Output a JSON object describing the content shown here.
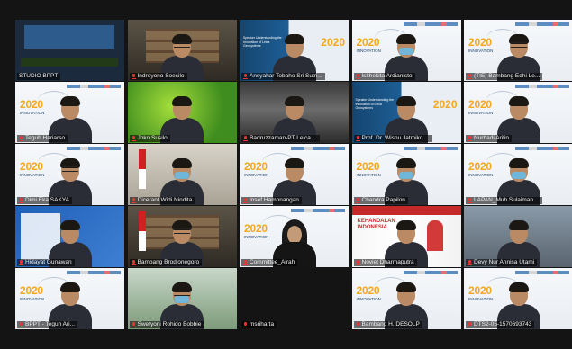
{
  "participants": [
    {
      "label": "STUDIO BPPT",
      "bg": "stage",
      "active": true,
      "muted": false
    },
    {
      "label": "Indroyono Soesilo",
      "bg": "room",
      "muted": true
    },
    {
      "label": "Ansyahar Tobaho Sri Sutri...",
      "bg": "blue",
      "muted": true
    },
    {
      "label": "Iskhekita Ardianisto",
      "bg": "tech",
      "muted": true
    },
    {
      "label": "(TIE) Bambang Edhi Le...",
      "bg": "tech",
      "muted": true
    },
    {
      "label": "Teguh Hariarso",
      "bg": "tech",
      "muted": true
    },
    {
      "label": "Joko Susilo",
      "bg": "green",
      "muted": true
    },
    {
      "label": "Badruzzaman-PT Leica ...",
      "bg": "hall",
      "muted": true
    },
    {
      "label": "Prof. Dr. Wisnu Jatmiko ...",
      "bg": "blue",
      "muted": true
    },
    {
      "label": "Nurhadi Arifin",
      "bg": "tech",
      "muted": true
    },
    {
      "label": "Dimi Eka SAKYA",
      "bg": "tech",
      "muted": true
    },
    {
      "label": "Dicerant Widi Nindita",
      "bg": "office",
      "muted": true
    },
    {
      "label": "Insef Hamonangan",
      "bg": "tech",
      "muted": true
    },
    {
      "label": "Chandra Papilon",
      "bg": "tech",
      "muted": true
    },
    {
      "label": "LAPAN_Muh Sulaiman ...",
      "bg": "tech",
      "muted": true
    },
    {
      "label": "Hidayat Gunawan",
      "bg": "poster",
      "muted": true
    },
    {
      "label": "Bambang Brodjonegoro",
      "bg": "room",
      "muted": true
    },
    {
      "label": "Committee_Airah",
      "bg": "tech",
      "muted": true
    },
    {
      "label": "Noviet Dharmaputra",
      "bg": "red",
      "muted": true
    },
    {
      "label": "Devy Nur Annisa Utami",
      "bg": "lobby",
      "muted": true
    },
    {
      "label": "BPPT - Teguh Ari...",
      "bg": "tech",
      "muted": true
    },
    {
      "label": "Swetyoni Rohido Bobbie",
      "bg": "outdoor",
      "muted": true
    },
    {
      "label": "msriharta",
      "bg": "empty",
      "muted": true
    },
    {
      "label": "Bambang H. DESOLP",
      "bg": "tech",
      "muted": true
    },
    {
      "label": "DTS2-05-1570693743",
      "bg": "tech",
      "muted": true
    }
  ],
  "background_logo": {
    "year": "2020",
    "tag": "INNOVATION"
  },
  "tech_panel_text": "Speaker Understanding the Innovation of Leica Geosystems",
  "red_banner_title": "KEHANDALAN INDONESIA",
  "colors": {
    "active_border": "#e8d63a",
    "muted_icon": "#e33333",
    "accent": "#f4a81c"
  }
}
